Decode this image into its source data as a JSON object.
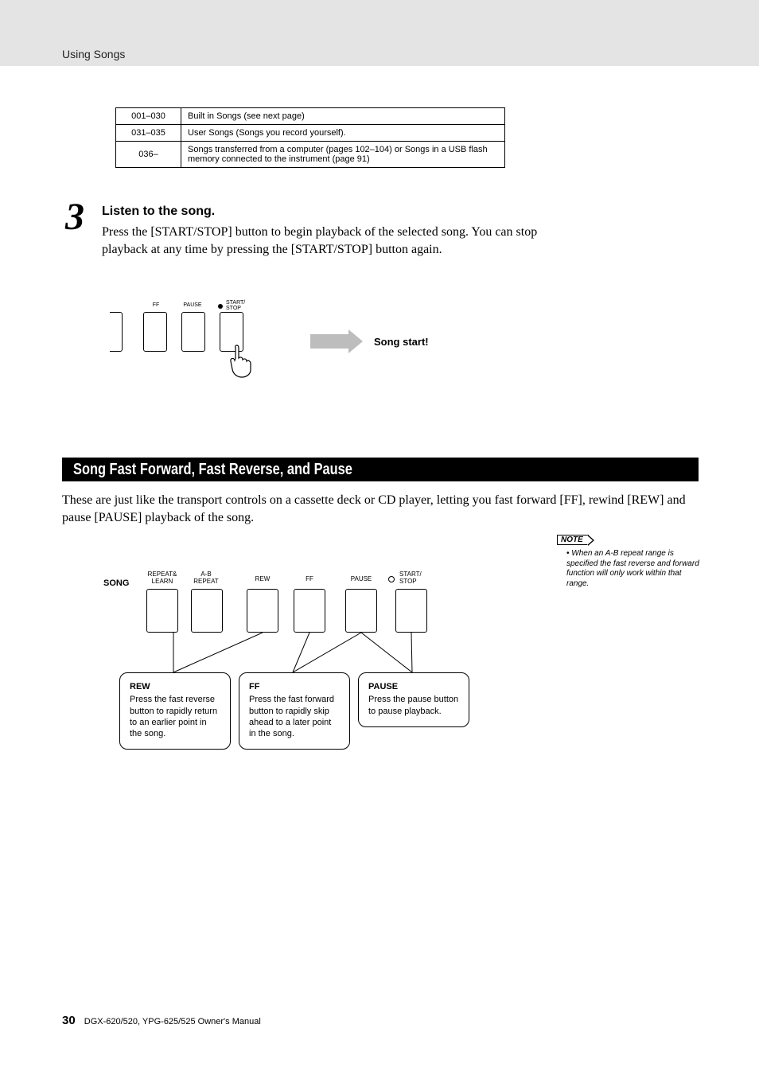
{
  "header": {
    "section_title": "Using Songs"
  },
  "table": {
    "rows": [
      {
        "range": "001–030",
        "desc": "Built in Songs (see next page)"
      },
      {
        "range": "031–035",
        "desc": "User Songs (Songs you record yourself)."
      },
      {
        "range": "036–",
        "desc": "Songs transferred from a computer (pages 102–104) or Songs in a USB flash memory connected to the instrument (page 91)"
      }
    ]
  },
  "step": {
    "number": "3",
    "heading": "Listen to the song.",
    "body": "Press the [START/STOP] button to begin playback of the selected song. You can stop playback at any time by pressing the [START/STOP] button again."
  },
  "panel1": {
    "labels": {
      "ff": "FF",
      "pause": "PAUSE",
      "start_stop1": "START/",
      "start_stop2": "STOP"
    },
    "song_start": "Song start!"
  },
  "section2": {
    "title": "Song Fast Forward, Fast Reverse, and Pause",
    "body": "These are just like the transport controls on a cassette deck or CD player, letting you fast forward [FF], rewind [REW] and pause [PAUSE] playback of the song."
  },
  "note": {
    "label": "NOTE",
    "items": [
      "When an A-B repeat range is specified the fast reverse and forward function will only work within that range."
    ]
  },
  "panel2": {
    "song_label": "SONG",
    "labels": {
      "repeat_learn1": "REPEAT&",
      "repeat_learn2": "LEARN",
      "ab1": "A-B",
      "ab2": "REPEAT",
      "rew": "REW",
      "ff": "FF",
      "pause": "PAUSE",
      "start1": "START/",
      "start2": "STOP"
    }
  },
  "callouts": {
    "rew": {
      "title": "REW",
      "body": "Press the fast reverse button to rapidly return to an earlier point in the song."
    },
    "ff": {
      "title": "FF",
      "body": "Press the fast forward button to rapidly skip ahead to a later point in the song."
    },
    "pause": {
      "title": "PAUSE",
      "body": "Press the pause button to pause playback."
    }
  },
  "footer": {
    "page": "30",
    "doc": "DGX-620/520, YPG-625/525  Owner's Manual"
  }
}
